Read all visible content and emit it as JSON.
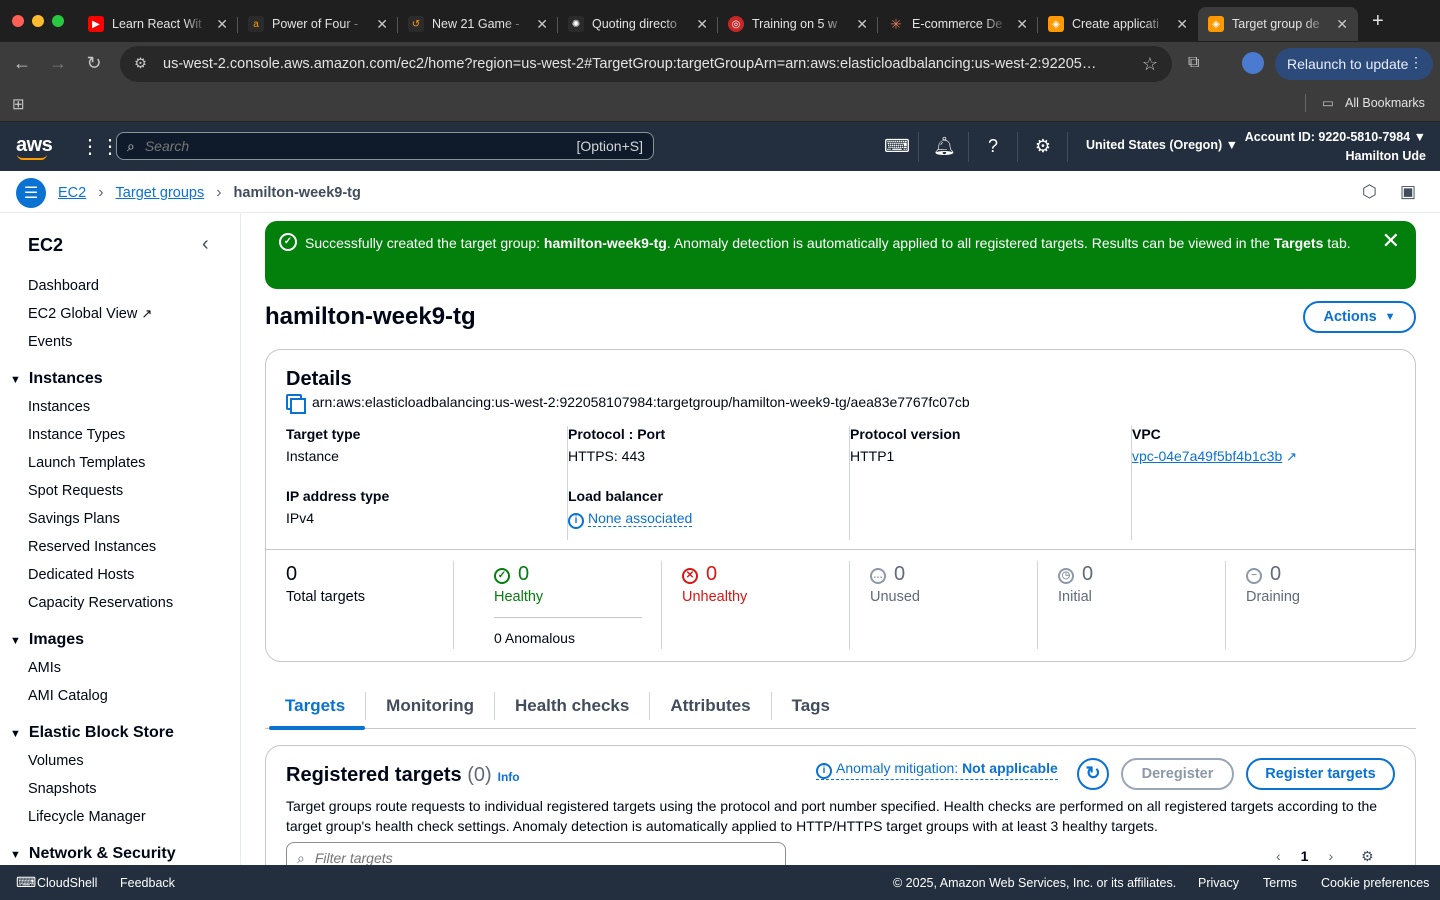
{
  "browser": {
    "tabs": [
      {
        "title": "Learn React Wit",
        "fav_color": "#ff0000",
        "fav_icon": "youtube-icon"
      },
      {
        "title": "Power of Four -",
        "fav_color": "#2b2b2b",
        "fav_icon": "aws-icon"
      },
      {
        "title": "New 21 Game -",
        "fav_color": "#2b2b2b",
        "fav_icon": "leetcode-icon"
      },
      {
        "title": "Quoting directo",
        "fav_color": "#2b2b2b",
        "fav_icon": "openai-icon"
      },
      {
        "title": "Training on 5 w",
        "fav_color": "#c62828",
        "fav_icon": "target-icon"
      },
      {
        "title": "E-commerce De",
        "fav_color": "#2b2b2b",
        "fav_icon": "claude-icon"
      },
      {
        "title": "Create applicati",
        "fav_color": "#ff9900",
        "fav_icon": "aws-console-icon"
      },
      {
        "title": "Target group de",
        "fav_color": "#ff9900",
        "fav_icon": "aws-console-icon",
        "active": true
      }
    ],
    "url": "us-west-2.console.aws.amazon.com/ec2/home?region=us-west-2#TargetGroup:targetGroupArn=arn:aws:elasticloadbalancing:us-west-2:92205…",
    "relaunch_label": "Relaunch to update",
    "bookmarks_label": "All Bookmarks"
  },
  "aws_header": {
    "logo": "aws",
    "search_placeholder": "Search",
    "search_shortcut": "[Option+S]",
    "region": "United States (Oregon)",
    "account_id": "Account ID: 9220-5810-7984",
    "user": "Hamilton Ude"
  },
  "breadcrumb": {
    "items": [
      "EC2",
      "Target groups"
    ],
    "current": "hamilton-week9-tg"
  },
  "sidebar": {
    "title": "EC2",
    "top_items": [
      "Dashboard",
      "EC2 Global View",
      "Events"
    ],
    "sections": [
      {
        "label": "Instances",
        "items": [
          "Instances",
          "Instance Types",
          "Launch Templates",
          "Spot Requests",
          "Savings Plans",
          "Reserved Instances",
          "Dedicated Hosts",
          "Capacity Reservations"
        ]
      },
      {
        "label": "Images",
        "items": [
          "AMIs",
          "AMI Catalog"
        ]
      },
      {
        "label": "Elastic Block Store",
        "items": [
          "Volumes",
          "Snapshots",
          "Lifecycle Manager"
        ]
      },
      {
        "label": "Network & Security",
        "items": []
      }
    ]
  },
  "flash": {
    "prefix": "Successfully created the target group: ",
    "name": "hamilton-week9-tg",
    "middle": ". Anomaly detection is automatically applied to all registered targets. Results can be viewed in the ",
    "tab_ref": "Targets",
    "suffix": "tab."
  },
  "page_title": "hamilton-week9-tg",
  "actions_label": "Actions",
  "details": {
    "heading": "Details",
    "arn": "arn:aws:elasticloadbalancing:us-west-2:922058107984:targetgroup/hamilton-week9-tg/aea83e7767fc07cb",
    "target_type": {
      "label": "Target type",
      "value": "Instance"
    },
    "protocol_port": {
      "label": "Protocol : Port",
      "value": "HTTPS: 443"
    },
    "protocol_version": {
      "label": "Protocol version",
      "value": "HTTP1"
    },
    "vpc": {
      "label": "VPC",
      "value": "vpc-04e7a49f5bf4b1c3b"
    },
    "ip_type": {
      "label": "IP address type",
      "value": "IPv4"
    },
    "load_balancer": {
      "label": "Load balancer",
      "value": "None associated"
    }
  },
  "stats": {
    "total": {
      "value": "0",
      "label": "Total targets"
    },
    "healthy": {
      "value": "0",
      "label": "Healthy",
      "color": "#037f0c"
    },
    "anomalous": "0 Anomalous",
    "unhealthy": {
      "value": "0",
      "label": "Unhealthy",
      "color": "#d91515"
    },
    "unused": {
      "value": "0",
      "label": "Unused"
    },
    "initial": {
      "value": "0",
      "label": "Initial"
    },
    "draining": {
      "value": "0",
      "label": "Draining"
    }
  },
  "tabs": [
    "Targets",
    "Monitoring",
    "Health checks",
    "Attributes",
    "Tags"
  ],
  "registered": {
    "title": "Registered targets",
    "count": "(0)",
    "info": "Info",
    "anomaly_label": "Anomaly mitigation: ",
    "anomaly_value": "Not applicable",
    "deregister": "Deregister",
    "register": "Register targets",
    "description": "Target groups route requests to individual registered targets using the protocol and port number specified. Health checks are performed on all registered targets according to the target group's health check settings. Anomaly detection is automatically applied to HTTP/HTTPS target groups with at least 3 healthy targets.",
    "filter_placeholder": "Filter targets",
    "page": "1"
  },
  "footer": {
    "cloudshell": "CloudShell",
    "feedback": "Feedback",
    "copyright": "© 2025, Amazon Web Services, Inc. or its affiliates.",
    "privacy": "Privacy",
    "terms": "Terms",
    "cookies": "Cookie preferences"
  }
}
